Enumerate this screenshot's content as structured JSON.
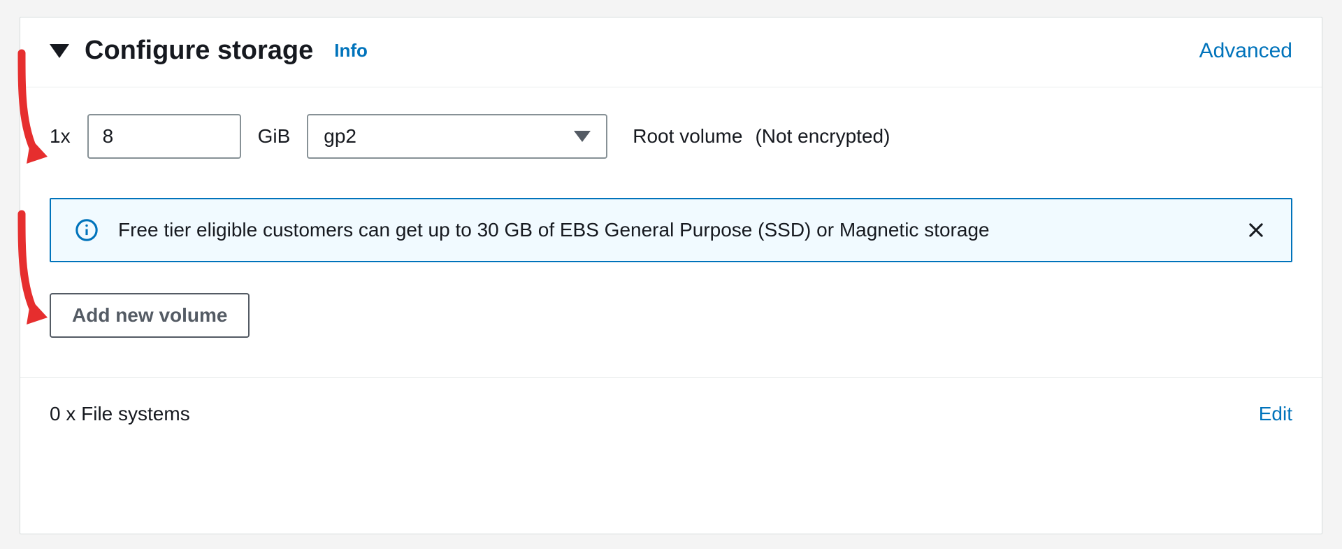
{
  "header": {
    "title": "Configure storage",
    "info_label": "Info",
    "advanced_label": "Advanced"
  },
  "volume": {
    "quantity_label": "1x",
    "size_value": "8",
    "unit_label": "GiB",
    "type_selected": "gp2",
    "name_label": "Root volume",
    "encryption_label": "(Not encrypted)"
  },
  "banner": {
    "text": "Free tier eligible customers can get up to 30 GB of EBS General Purpose (SSD) or Magnetic storage"
  },
  "buttons": {
    "add_volume": "Add new volume"
  },
  "filesystems": {
    "summary": "0 x File systems",
    "edit_label": "Edit"
  },
  "colors": {
    "link": "#0073bb",
    "border": "#879196",
    "banner_bg": "#f1faff",
    "annotation": "#e62e2e"
  }
}
